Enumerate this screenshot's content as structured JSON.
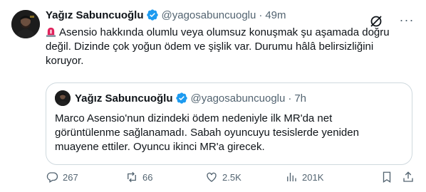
{
  "tweet": {
    "author_name": "Yağız Sabuncuoğlu",
    "handle": "@yagosabuncuoglu",
    "separator": "·",
    "time": "49m",
    "text": "Asensio hakkında olumlu veya olumsuz konuşmak şu aşamada doğru değil. Dizinde çok yoğun ödem ve şişlik var. Durumu hâlâ belirsizliğini koruyor.",
    "more_label": "···"
  },
  "quote": {
    "author_name": "Yağız Sabuncuoğlu",
    "handle": "@yagosabuncuoglu",
    "separator": "·",
    "time": "7h",
    "text": "Marco Asensio'nun dizindeki ödem nedeniyle ilk MR'da net görüntülenme sağlanamadı. Sabah oyuncuyu tesislerde yeniden muayene ettiler. Oyuncu ikinci MR'a girecek."
  },
  "actions": {
    "replies": "267",
    "reposts": "66",
    "likes": "2.5K",
    "views": "201K"
  },
  "colors": {
    "verified": "#1d9bf0",
    "secondary_text": "#536471",
    "border": "#cfd9de"
  },
  "icons": [
    "verified-badge-icon",
    "siren-emoji-icon",
    "grok-icon",
    "more-icon",
    "reply-icon",
    "repost-icon",
    "like-icon",
    "views-icon",
    "bookmark-icon",
    "share-icon"
  ]
}
